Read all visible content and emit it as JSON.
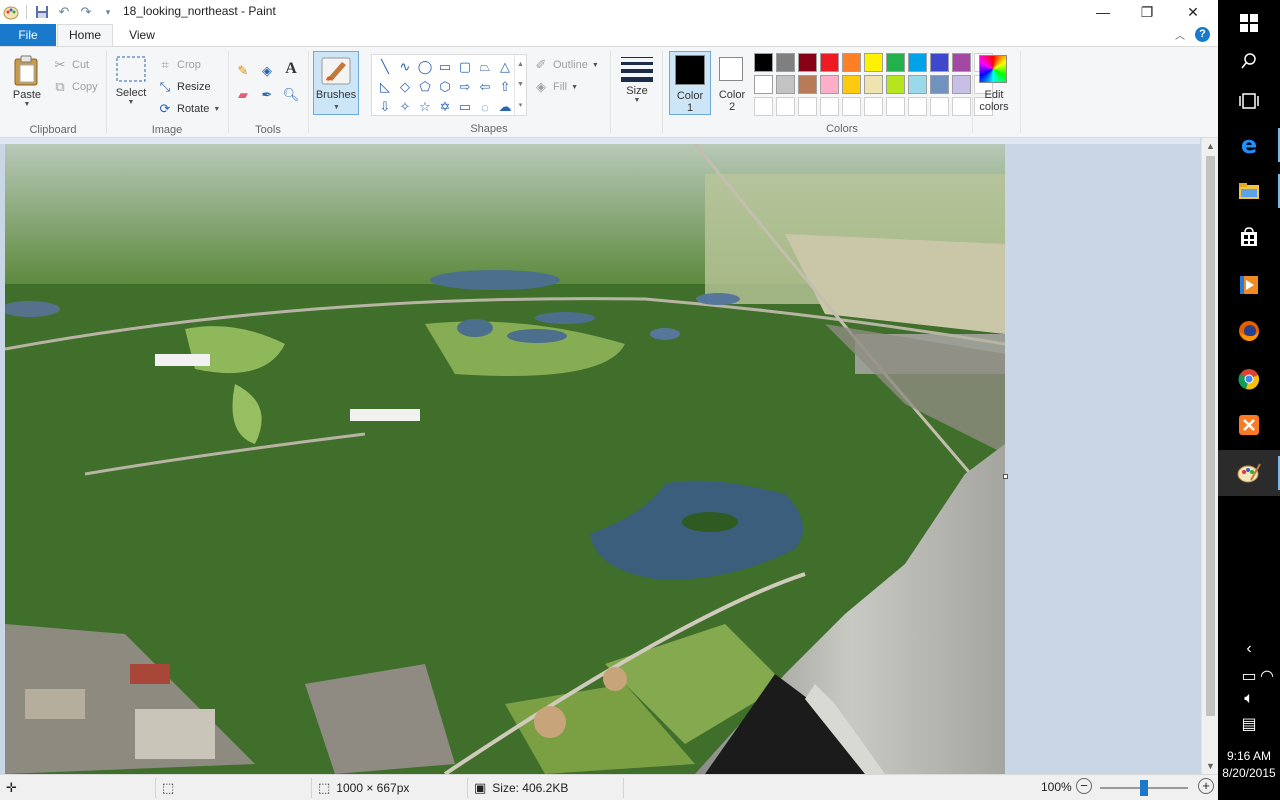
{
  "window": {
    "title": "18_looking_northeast - Paint",
    "minimize": "—",
    "restore": "❐",
    "close": "✕"
  },
  "tabs": {
    "file": "File",
    "home": "Home",
    "view": "View"
  },
  "ribbon": {
    "clipboard": {
      "label": "Clipboard",
      "paste": "Paste",
      "cut": "Cut",
      "copy": "Copy"
    },
    "image": {
      "label": "Image",
      "select": "Select",
      "crop": "Crop",
      "resize": "Resize",
      "rotate": "Rotate"
    },
    "tools": {
      "label": "Tools"
    },
    "brushes": "Brushes",
    "shapes": {
      "label": "Shapes",
      "outline": "Outline",
      "fill": "Fill"
    },
    "size": "Size",
    "colors": {
      "label": "Colors",
      "color1_label": "Color",
      "color1_num": "1",
      "color2_label": "Color",
      "color2_num": "2",
      "edit_label": "Edit",
      "edit_label2": "colors",
      "color1": "#000000",
      "color2": "#ffffff",
      "palette_row1": [
        "#000000",
        "#7f7f7f",
        "#880015",
        "#ed1c24",
        "#ff7f27",
        "#fff200",
        "#22b14c",
        "#00a2e8",
        "#3f48cc",
        "#a349a4"
      ],
      "palette_row2": [
        "#ffffff",
        "#c3c3c3",
        "#b97a57",
        "#ffaec9",
        "#ffc90e",
        "#efe4b0",
        "#b5e61d",
        "#99d9ea",
        "#7092be",
        "#c8bfe7"
      ]
    }
  },
  "canvas": {
    "description": "aerial photo looking northeast"
  },
  "status": {
    "dimensions": "1000 × 667px",
    "size": "Size: 406.2KB",
    "zoom": "100%"
  },
  "taskbar": {
    "time": "9:16 AM",
    "date": "8/20/2015"
  }
}
